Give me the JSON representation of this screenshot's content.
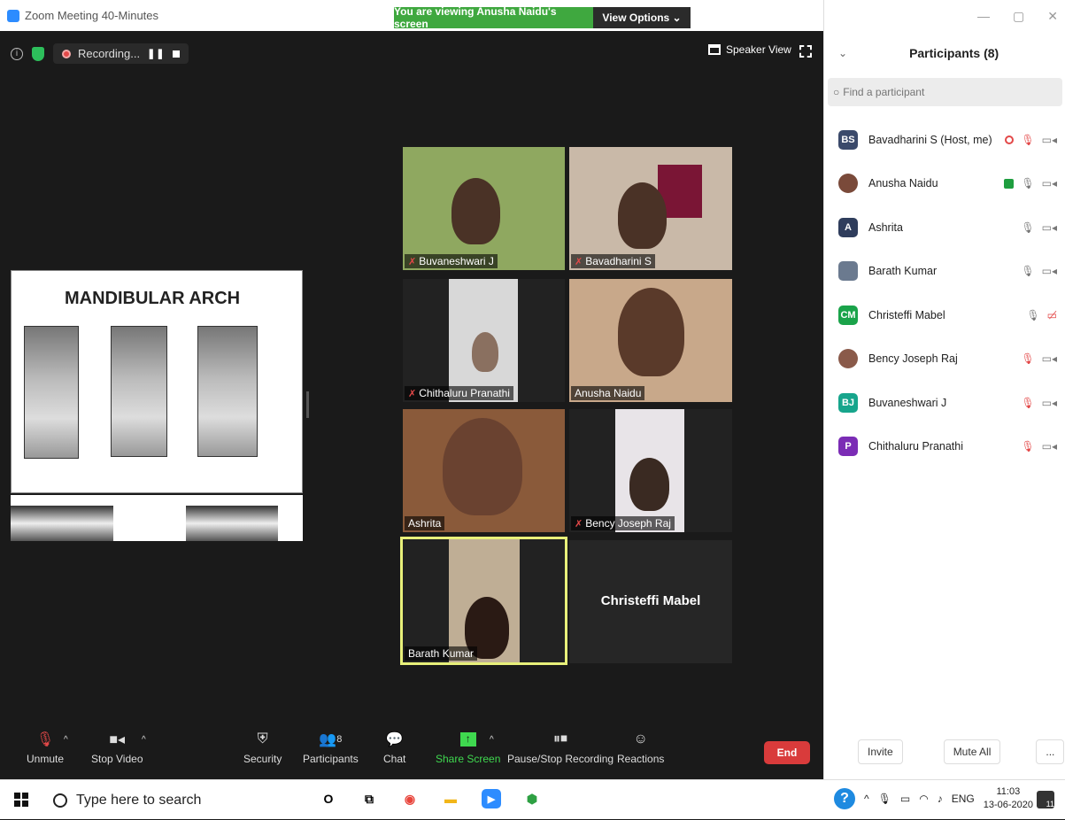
{
  "window": {
    "title": "Zoom Meeting 40-Minutes"
  },
  "banner": {
    "viewing": "You are viewing Anusha Naidu's screen",
    "view_options": "View Options ⌄"
  },
  "top_controls": {
    "recording": "Recording...",
    "speaker_view": "Speaker View"
  },
  "slide": {
    "title": "MANDIBULAR ARCH"
  },
  "tiles": [
    {
      "name": "Buvaneshwari J",
      "muted": true
    },
    {
      "name": "Bavadharini S",
      "muted": true
    },
    {
      "name": "Chithaluru Pranathi",
      "muted": true
    },
    {
      "name": "Anusha Naidu",
      "muted": false
    },
    {
      "name": "Ashrita",
      "muted": false
    },
    {
      "name": "Bency Joseph Raj",
      "muted": true
    },
    {
      "name": "Barath Kumar",
      "muted": false,
      "active_speaker": true
    },
    {
      "name": "Christeffi Mabel",
      "video_off": true
    }
  ],
  "toolbar": {
    "unmute": "Unmute",
    "stop_video": "Stop Video",
    "security": "Security",
    "participants": "Participants",
    "participants_count": "8",
    "chat": "Chat",
    "share_screen": "Share Screen",
    "pause_recording": "Pause/Stop Recording",
    "reactions": "Reactions",
    "end": "End"
  },
  "panel": {
    "title": "Participants (8)",
    "search_placeholder": "Find a participant",
    "participants": [
      {
        "initials": "BS",
        "name": "Bavadharini S (Host, me)",
        "color": "#3b4a6b"
      },
      {
        "initials": "",
        "name": "Anusha Naidu",
        "color": "#7a4a3a"
      },
      {
        "initials": "A",
        "name": "Ashrita",
        "color": "#2f3d5c"
      },
      {
        "initials": "",
        "name": "Barath Kumar",
        "color": "#6b7a8f"
      },
      {
        "initials": "CM",
        "name": "Christeffi Mabel",
        "color": "#1aa34a"
      },
      {
        "initials": "",
        "name": "Bency Joseph Raj",
        "color": "#8a5a4a"
      },
      {
        "initials": "BJ",
        "name": "Buvaneshwari J",
        "color": "#17a58c"
      },
      {
        "initials": "P",
        "name": "Chithaluru Pranathi",
        "color": "#7b2cb5"
      }
    ],
    "invite": "Invite",
    "mute_all": "Mute All",
    "more": "..."
  },
  "taskbar": {
    "search_placeholder": "Type here to search",
    "lang": "ENG",
    "time": "11:03",
    "date": "13-06-2020",
    "notifications": "11"
  }
}
